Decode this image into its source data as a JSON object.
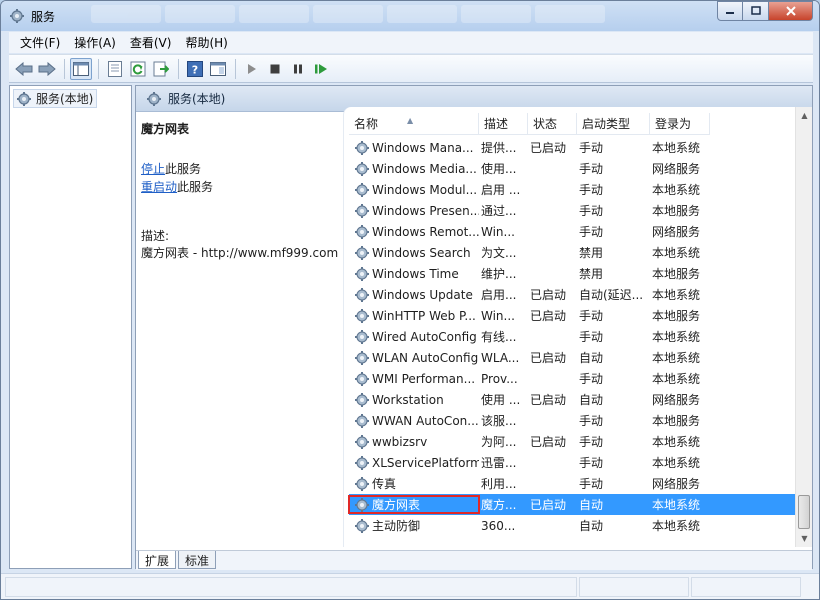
{
  "window": {
    "title": "服务"
  },
  "menu": [
    "文件(F)",
    "操作(A)",
    "查看(V)",
    "帮助(H)"
  ],
  "toolbar": [
    "back-icon",
    "forward-icon",
    "show-hide-tree-icon",
    "properties-icon",
    "refresh-icon",
    "export-list-icon",
    "help-icon",
    "show-pane-icon",
    "start-icon",
    "stop-icon",
    "pause-icon",
    "restart-icon"
  ],
  "tree": {
    "root": "服务(本地)"
  },
  "content": {
    "header": "服务(本地)",
    "selected_name": "魔方网表",
    "stop_link": "停止",
    "stop_suffix": "此服务",
    "restart_link": "重启动",
    "restart_suffix": "此服务",
    "desc_label": "描述:",
    "desc_text": "魔方网表 - http://www.mf999.com"
  },
  "columns": {
    "name": "名称",
    "desc": "描述",
    "status": "状态",
    "startup": "启动类型",
    "logon": "登录为"
  },
  "services": [
    {
      "name": "Windows Mana...",
      "desc": "提供...",
      "status": "已启动",
      "startup": "手动",
      "logon": "本地系统"
    },
    {
      "name": "Windows Media...",
      "desc": "使用...",
      "status": "",
      "startup": "手动",
      "logon": "网络服务"
    },
    {
      "name": "Windows Modul...",
      "desc": "启用 ...",
      "status": "",
      "startup": "手动",
      "logon": "本地系统"
    },
    {
      "name": "Windows Presen...",
      "desc": "通过...",
      "status": "",
      "startup": "手动",
      "logon": "本地服务"
    },
    {
      "name": "Windows Remot...",
      "desc": "Win...",
      "status": "",
      "startup": "手动",
      "logon": "网络服务"
    },
    {
      "name": "Windows Search",
      "desc": "为文...",
      "status": "",
      "startup": "禁用",
      "logon": "本地系统"
    },
    {
      "name": "Windows Time",
      "desc": "维护...",
      "status": "",
      "startup": "禁用",
      "logon": "本地服务"
    },
    {
      "name": "Windows Update",
      "desc": "启用...",
      "status": "已启动",
      "startup": "自动(延迟...",
      "logon": "本地系统"
    },
    {
      "name": "WinHTTP Web P...",
      "desc": "Win...",
      "status": "已启动",
      "startup": "手动",
      "logon": "本地服务"
    },
    {
      "name": "Wired AutoConfig",
      "desc": "有线...",
      "status": "",
      "startup": "手动",
      "logon": "本地系统"
    },
    {
      "name": "WLAN AutoConfig",
      "desc": "WLA...",
      "status": "已启动",
      "startup": "自动",
      "logon": "本地系统"
    },
    {
      "name": "WMI Performan...",
      "desc": "Prov...",
      "status": "",
      "startup": "手动",
      "logon": "本地系统"
    },
    {
      "name": "Workstation",
      "desc": "使用 ...",
      "status": "已启动",
      "startup": "自动",
      "logon": "网络服务"
    },
    {
      "name": "WWAN AutoCon...",
      "desc": "该服...",
      "status": "",
      "startup": "手动",
      "logon": "本地服务"
    },
    {
      "name": "wwbizsrv",
      "desc": "为阿...",
      "status": "已启动",
      "startup": "手动",
      "logon": "本地系统"
    },
    {
      "name": "XLServicePlatform",
      "desc": "迅雷...",
      "status": "",
      "startup": "手动",
      "logon": "本地系统"
    },
    {
      "name": "传真",
      "desc": "利用...",
      "status": "",
      "startup": "手动",
      "logon": "网络服务"
    },
    {
      "name": "魔方网表",
      "desc": "魔方...",
      "status": "已启动",
      "startup": "自动",
      "logon": "本地系统",
      "selected": true
    },
    {
      "name": "主动防御",
      "desc": "360...",
      "status": "",
      "startup": "自动",
      "logon": "本地系统"
    }
  ],
  "tabs": [
    "扩展",
    "标准"
  ]
}
